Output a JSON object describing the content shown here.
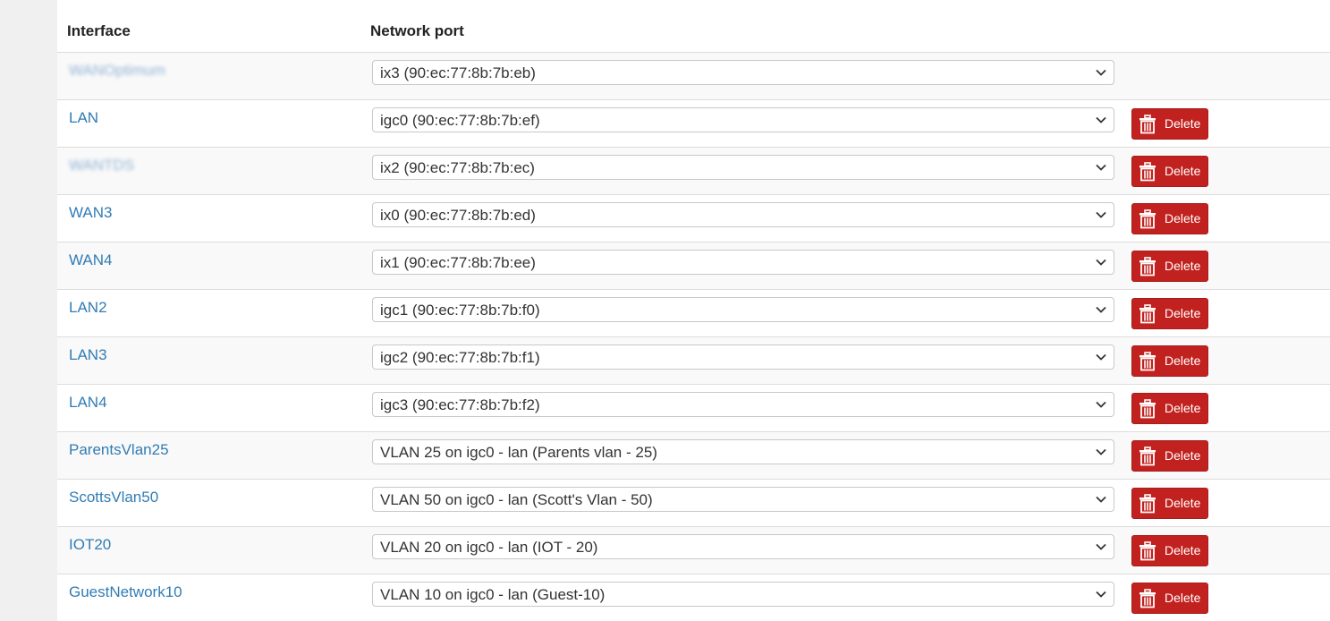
{
  "table": {
    "headers": {
      "interface": "Interface",
      "network_port": "Network port"
    },
    "delete_label": "Delete",
    "rows": [
      {
        "interface": "WANOptimum",
        "port": "ix3 (90:ec:77:8b:7b:eb)",
        "blurred": true,
        "has_delete": false
      },
      {
        "interface": "LAN",
        "port": "igc0 (90:ec:77:8b:7b:ef)",
        "blurred": false,
        "has_delete": true
      },
      {
        "interface": "WANTDS",
        "port": "ix2 (90:ec:77:8b:7b:ec)",
        "blurred": true,
        "has_delete": true
      },
      {
        "interface": "WAN3",
        "port": "ix0 (90:ec:77:8b:7b:ed)",
        "blurred": false,
        "has_delete": true
      },
      {
        "interface": "WAN4",
        "port": "ix1 (90:ec:77:8b:7b:ee)",
        "blurred": false,
        "has_delete": true
      },
      {
        "interface": "LAN2",
        "port": "igc1 (90:ec:77:8b:7b:f0)",
        "blurred": false,
        "has_delete": true
      },
      {
        "interface": "LAN3",
        "port": "igc2 (90:ec:77:8b:7b:f1)",
        "blurred": false,
        "has_delete": true
      },
      {
        "interface": "LAN4",
        "port": "igc3 (90:ec:77:8b:7b:f2)",
        "blurred": false,
        "has_delete": true
      },
      {
        "interface": "ParentsVlan25",
        "port": "VLAN 25 on igc0 - lan (Parents vlan - 25)",
        "blurred": false,
        "has_delete": true
      },
      {
        "interface": "ScottsVlan50",
        "port": "VLAN 50 on igc0 - lan (Scott's Vlan - 50)",
        "blurred": false,
        "has_delete": true
      },
      {
        "interface": "IOT20",
        "port": "VLAN 20 on igc0 - lan (IOT - 20)",
        "blurred": false,
        "has_delete": true
      },
      {
        "interface": "GuestNetwork10",
        "port": "VLAN 10 on igc0 - lan (Guest-10)",
        "blurred": false,
        "has_delete": true
      }
    ]
  },
  "colors": {
    "link": "#317cb4",
    "delete_button": "#c1221f",
    "row_stripe": "#f9f9f9"
  },
  "icons": {
    "delete": "trash-icon",
    "select": "chevron-down-icon"
  }
}
